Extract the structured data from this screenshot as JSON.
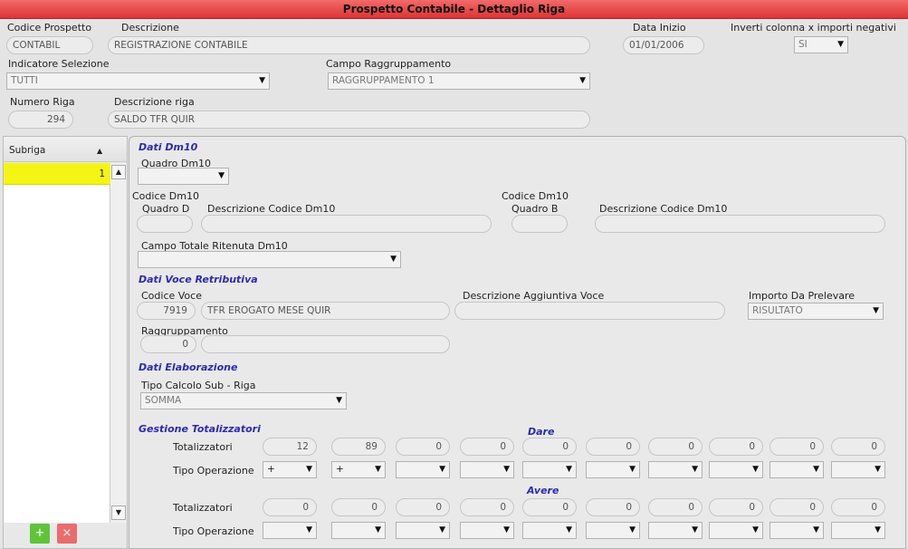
{
  "window": {
    "title": "Prospetto Contabile - Dettaglio Riga"
  },
  "header": {
    "codice_prospetto": {
      "label": "Codice Prospetto",
      "value": "CONTABIL"
    },
    "descrizione": {
      "label": "Descrizione",
      "value": "REGISTRAZIONE CONTABILE"
    },
    "data_inizio": {
      "label": "Data Inizio",
      "value": "01/01/2006"
    },
    "inverti": {
      "label": "Inverti colonna x importi negativi",
      "value": "SI"
    },
    "indicatore_selezione": {
      "label": "Indicatore Selezione",
      "value": "TUTTI"
    },
    "campo_raggruppamento": {
      "label": "Campo Raggruppamento",
      "value": "RAGGRUPPAMENTO 1"
    },
    "numero_riga": {
      "label": "Numero Riga",
      "value": "294"
    },
    "descrizione_riga": {
      "label": "Descrizione riga",
      "value": "SALDO TFR QUIR"
    }
  },
  "subriga": {
    "header": "Subriga",
    "sort_icon": "triangle-up-icon",
    "rows": [
      "1"
    ],
    "add_icon": "plus-icon",
    "delete_icon": "x-icon",
    "add_color": "#5fc43a",
    "delete_color": "#ea6b6b",
    "selected_color": "#f5f514"
  },
  "dm10": {
    "section": "Dati Dm10",
    "quadro_label": "Quadro Dm10",
    "quadro_value": "",
    "codice_d_label": "Codice Dm10",
    "quadro_d_label": "Quadro D",
    "desc_d_label": "Descrizione Codice Dm10",
    "codice_b_label": "Codice Dm10",
    "quadro_b_label": "Quadro B",
    "desc_b_label": "Descrizione Codice Dm10",
    "totale_label": "Campo Totale Ritenuta Dm10",
    "totale_value": ""
  },
  "voce": {
    "section": "Dati Voce Retributiva",
    "codice_label": "Codice Voce",
    "codice_value": "7919",
    "codice_desc": "TFR EROGATO MESE QUIR",
    "agg_label": "Descrizione Aggiuntiva Voce",
    "agg_value": "",
    "importo_label": "Importo Da Prelevare",
    "importo_value": "RISULTATO",
    "ragg_label": "Raggruppamento",
    "ragg_value": "0",
    "ragg_desc": ""
  },
  "elaborazione": {
    "section": "Dati Elaborazione",
    "tipo_label": "Tipo Calcolo Sub - Riga",
    "tipo_value": "SOMMA"
  },
  "totalizzatori": {
    "section": "Gestione Totalizzatori",
    "dare_label": "Dare",
    "avere_label": "Avere",
    "row_tot_label": "Totalizzatori",
    "row_op_label": "Tipo Operazione",
    "dare_values": [
      "12",
      "89",
      "0",
      "0",
      "0",
      "0",
      "0",
      "0",
      "0",
      "0"
    ],
    "dare_ops": [
      "+",
      "+",
      "",
      "",
      "",
      "",
      "",
      "",
      "",
      ""
    ],
    "avere_values": [
      "0",
      "0",
      "0",
      "0",
      "0",
      "0",
      "0",
      "0",
      "0",
      "0"
    ],
    "avere_ops": [
      "",
      "",
      "",
      "",
      "",
      "",
      "",
      "",
      "",
      ""
    ]
  },
  "colors": {
    "titlebar": "#e84a4a",
    "section_title": "#2b2bb2"
  }
}
